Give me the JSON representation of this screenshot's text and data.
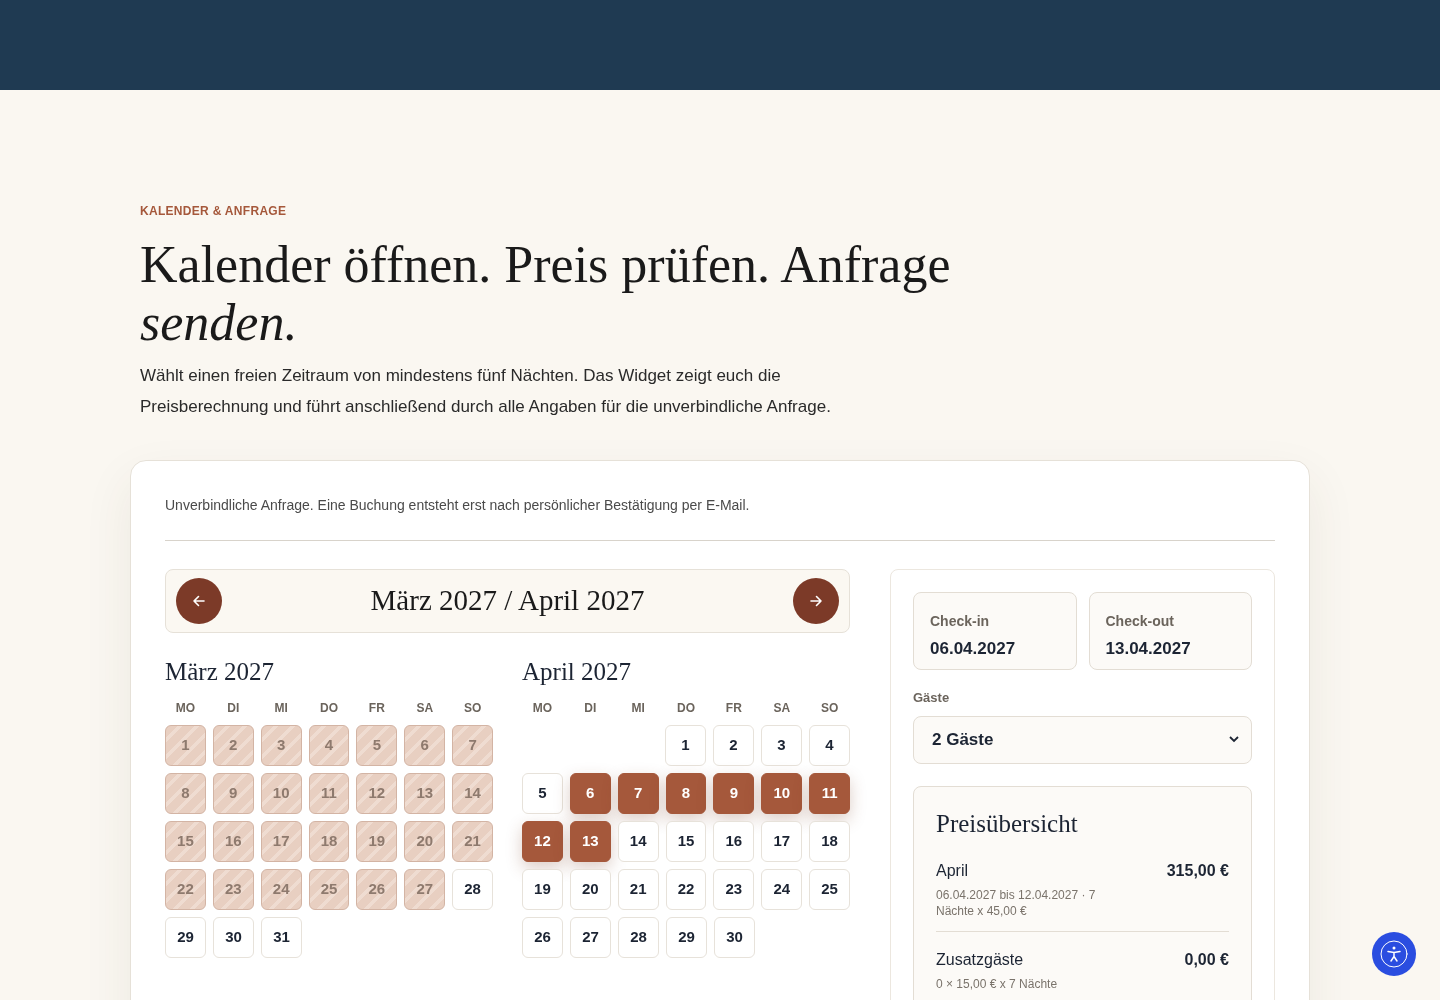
{
  "eyebrow": "KALENDER & ANFRAGE",
  "headline": {
    "text": "Kalender öffnen. Preis prüfen. Anfrage",
    "emphasis": "senden."
  },
  "intro": "Wählt einen freien Zeitraum von mindestens fünf Nächten. Das Widget zeigt euch die Preisberechnung und führt anschließend durch alle Angaben für die unverbindliche Anfrage.",
  "notice": "Unverbindliche Anfrage. Eine Buchung entsteht erst nach persönlicher Bestätigung per E-Mail.",
  "nav": {
    "title": "März 2027 / April 2027"
  },
  "months": [
    {
      "title": "März 2027",
      "weekdays": [
        "MO",
        "DI",
        "MI",
        "DO",
        "FR",
        "SA",
        "SO"
      ],
      "weeks": [
        {
          "kind": "start",
          "days": [
            {
              "label": "1",
              "disabled": true,
              "selected": false
            },
            {
              "label": "2",
              "disabled": true,
              "selected": false
            },
            {
              "label": "3",
              "disabled": true,
              "selected": false
            },
            {
              "label": "4",
              "disabled": true,
              "selected": false
            },
            {
              "label": "5",
              "disabled": true,
              "selected": false
            },
            {
              "label": "6",
              "disabled": true,
              "selected": false
            },
            {
              "label": "7",
              "disabled": true,
              "selected": false
            }
          ]
        },
        {
          "kind": "start",
          "days": [
            {
              "label": "8",
              "disabled": true,
              "selected": false
            },
            {
              "label": "9",
              "disabled": true,
              "selected": false
            },
            {
              "label": "10",
              "disabled": true,
              "selected": false
            },
            {
              "label": "11",
              "disabled": true,
              "selected": false
            },
            {
              "label": "12",
              "disabled": true,
              "selected": false
            },
            {
              "label": "13",
              "disabled": true,
              "selected": false
            },
            {
              "label": "14",
              "disabled": true,
              "selected": false
            }
          ]
        },
        {
          "kind": "start",
          "days": [
            {
              "label": "15",
              "disabled": true,
              "selected": false
            },
            {
              "label": "16",
              "disabled": true,
              "selected": false
            },
            {
              "label": "17",
              "disabled": true,
              "selected": false
            },
            {
              "label": "18",
              "disabled": true,
              "selected": false
            },
            {
              "label": "19",
              "disabled": true,
              "selected": false
            },
            {
              "label": "20",
              "disabled": true,
              "selected": false
            },
            {
              "label": "21",
              "disabled": true,
              "selected": false
            }
          ]
        },
        {
          "kind": "start",
          "days": [
            {
              "label": "22",
              "disabled": true,
              "selected": false
            },
            {
              "label": "23",
              "disabled": true,
              "selected": false
            },
            {
              "label": "24",
              "disabled": true,
              "selected": false
            },
            {
              "label": "25",
              "disabled": true,
              "selected": false
            },
            {
              "label": "26",
              "disabled": true,
              "selected": false
            },
            {
              "label": "27",
              "disabled": true,
              "selected": false
            },
            {
              "label": "28",
              "disabled": false,
              "selected": false
            }
          ]
        },
        {
          "kind": "start",
          "days": [
            {
              "label": "29",
              "disabled": false,
              "selected": false
            },
            {
              "label": "30",
              "disabled": false,
              "selected": false
            },
            {
              "label": "31",
              "disabled": false,
              "selected": false
            }
          ]
        }
      ]
    },
    {
      "title": "April 2027",
      "weekdays": [
        "MO",
        "DI",
        "MI",
        "DO",
        "FR",
        "SA",
        "SO"
      ],
      "weeks": [
        {
          "kind": "end",
          "days": [
            {
              "label": "1",
              "disabled": false,
              "selected": false
            },
            {
              "label": "2",
              "disabled": false,
              "selected": false
            },
            {
              "label": "3",
              "disabled": false,
              "selected": false
            },
            {
              "label": "4",
              "disabled": false,
              "selected": false
            }
          ]
        },
        {
          "kind": "start",
          "days": [
            {
              "label": "5",
              "disabled": false,
              "selected": false
            },
            {
              "label": "6",
              "disabled": false,
              "selected": true
            },
            {
              "label": "7",
              "disabled": false,
              "selected": true
            },
            {
              "label": "8",
              "disabled": false,
              "selected": true
            },
            {
              "label": "9",
              "disabled": false,
              "selected": true
            },
            {
              "label": "10",
              "disabled": false,
              "selected": true
            },
            {
              "label": "11",
              "disabled": false,
              "selected": true
            }
          ]
        },
        {
          "kind": "start",
          "days": [
            {
              "label": "12",
              "disabled": false,
              "selected": true
            },
            {
              "label": "13",
              "disabled": false,
              "selected": true
            },
            {
              "label": "14",
              "disabled": false,
              "selected": false
            },
            {
              "label": "15",
              "disabled": false,
              "selected": false
            },
            {
              "label": "16",
              "disabled": false,
              "selected": false
            },
            {
              "label": "17",
              "disabled": false,
              "selected": false
            },
            {
              "label": "18",
              "disabled": false,
              "selected": false
            }
          ]
        },
        {
          "kind": "start",
          "days": [
            {
              "label": "19",
              "disabled": false,
              "selected": false
            },
            {
              "label": "20",
              "disabled": false,
              "selected": false
            },
            {
              "label": "21",
              "disabled": false,
              "selected": false
            },
            {
              "label": "22",
              "disabled": false,
              "selected": false
            },
            {
              "label": "23",
              "disabled": false,
              "selected": false
            },
            {
              "label": "24",
              "disabled": false,
              "selected": false
            },
            {
              "label": "25",
              "disabled": false,
              "selected": false
            }
          ]
        },
        {
          "kind": "start",
          "days": [
            {
              "label": "26",
              "disabled": false,
              "selected": false
            },
            {
              "label": "27",
              "disabled": false,
              "selected": false
            },
            {
              "label": "28",
              "disabled": false,
              "selected": false
            },
            {
              "label": "29",
              "disabled": false,
              "selected": false
            },
            {
              "label": "30",
              "disabled": false,
              "selected": false
            }
          ]
        }
      ]
    }
  ],
  "dates": [
    {
      "label": "Check-in",
      "value": "06.04.2027"
    },
    {
      "label": "Check-out",
      "value": "13.04.2027"
    }
  ],
  "guests": {
    "label": "Gäste",
    "value": "2 Gäste"
  },
  "price_summary": {
    "title": "Preisübersicht",
    "rows": [
      {
        "label": "April",
        "detail": "06.04.2027 bis 12.04.2027 · 7 Nächte x 45,00 €",
        "amount": "315,00 €"
      },
      {
        "label": "Zusatzgäste",
        "detail": "0 × 15,00 € x 7 Nächte",
        "amount": "0,00 €"
      }
    ]
  }
}
